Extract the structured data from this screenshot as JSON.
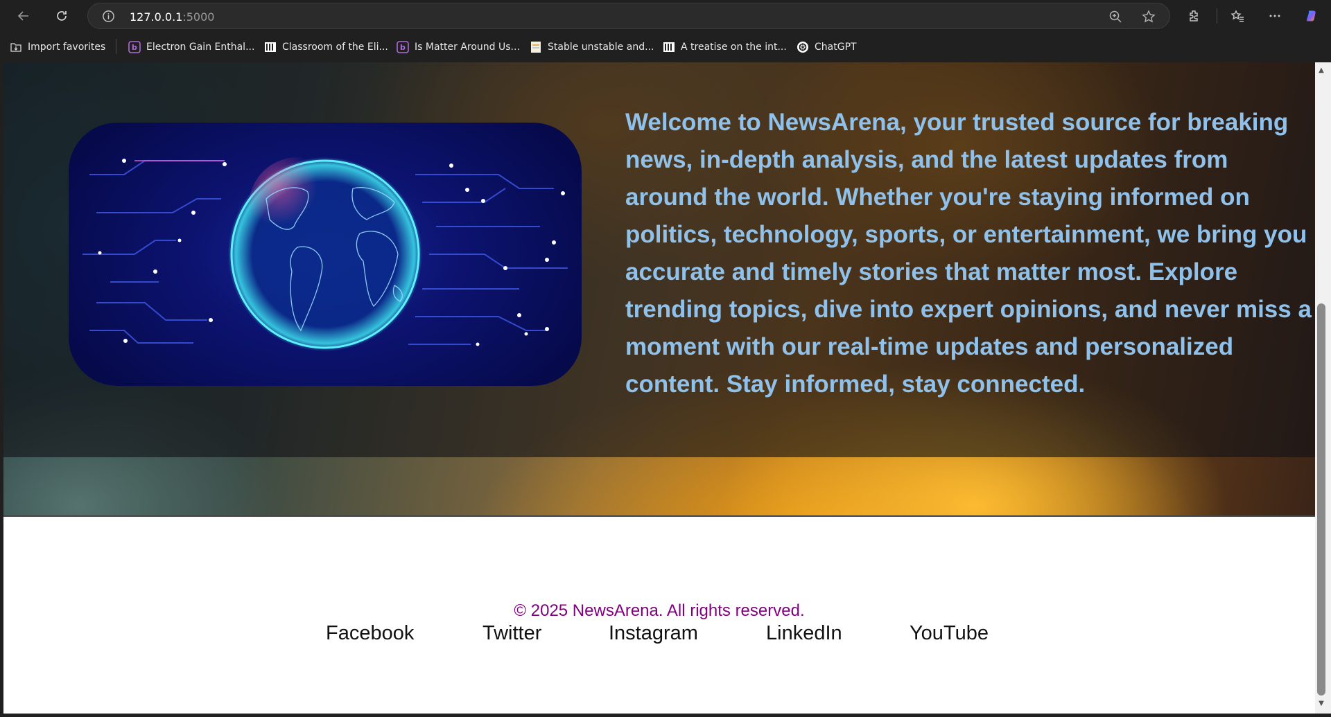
{
  "browser": {
    "url_host": "127.0.0.1",
    "url_port": ":5000",
    "icons": [
      "back-arrow-icon",
      "refresh-icon",
      "info-icon",
      "zoom-icon",
      "star-icon",
      "extensions-icon",
      "favorites-icon",
      "more-icon",
      "copilot-icon"
    ]
  },
  "bookmarks": [
    {
      "label": "Import favorites",
      "icon": "import-icon"
    },
    {
      "label": "Electron Gain Enthal...",
      "icon": "purple-b-icon"
    },
    {
      "label": "Classroom of the Eli...",
      "icon": "library-icon"
    },
    {
      "label": "Is Matter Around Us...",
      "icon": "purple-b-icon"
    },
    {
      "label": "Stable unstable and...",
      "icon": "page-icon"
    },
    {
      "label": "A treatise on the int...",
      "icon": "library-icon"
    },
    {
      "label": "ChatGPT",
      "icon": "chatgpt-icon"
    }
  ],
  "hero": {
    "welcome_text": "Welcome to NewsArena, your trusted source for breaking news, in-depth analysis, and the latest updates from around the world. Whether you're staying informed on politics, technology, sports, or entertainment, we bring you accurate and timely stories that matter most. Explore trending topics, dive into expert opinions, and never miss a moment with our real-time updates and personalized content. Stay informed, stay connected.",
    "text_color": "#8fc1ea"
  },
  "footer": {
    "copyright": "© 2025 NewsArena. All rights reserved.",
    "copyright_color": "#800080",
    "social_links": [
      "Facebook",
      "Twitter",
      "Instagram",
      "LinkedIn",
      "YouTube"
    ]
  }
}
